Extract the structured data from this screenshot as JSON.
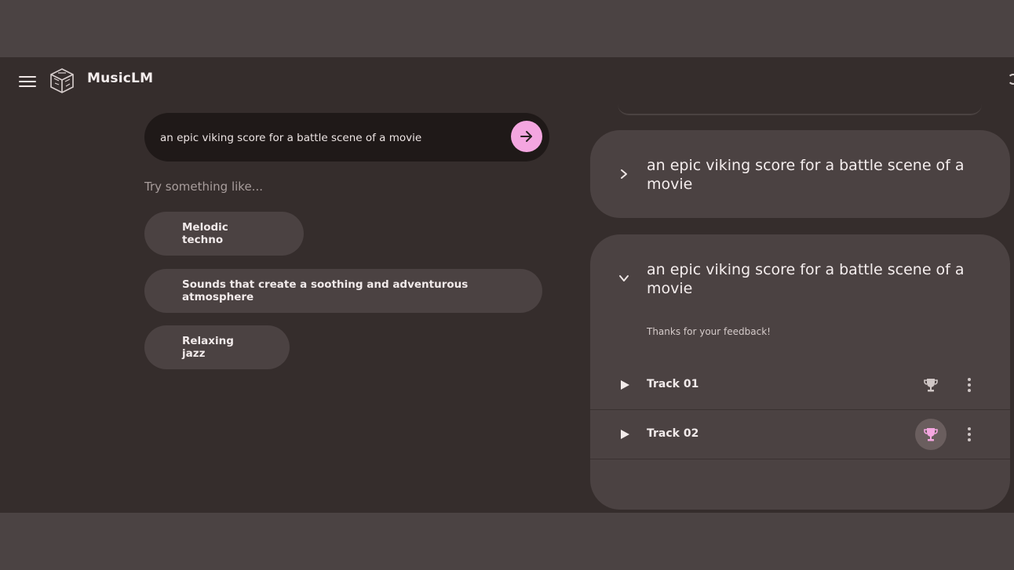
{
  "header": {
    "app_title": "MusicLM"
  },
  "prompt": {
    "value": "an epic viking score for a battle scene of a movie",
    "placeholder": ""
  },
  "suggestions": {
    "label": "Try something like...",
    "items": [
      "Melodic techno",
      "Sounds that create a soothing and adventurous atmosphere",
      "Relaxing jazz"
    ]
  },
  "results": [
    {
      "title": "an epic viking score for a battle scene of a movie",
      "expanded": false
    },
    {
      "title": "an epic viking score for a battle scene of a movie",
      "expanded": true,
      "feedback": "Thanks for your feedback!",
      "tracks": [
        {
          "name": "Track 01",
          "selected": false
        },
        {
          "name": "Track 02",
          "selected": true
        }
      ]
    }
  ],
  "colors": {
    "accent": "#f4a6e0",
    "background": "#352d2c",
    "card": "#4b4242",
    "input": "#1f1918"
  },
  "icons": {
    "menu": "menu-icon",
    "logo": "musiclm-logo",
    "submit": "arrow-right-icon",
    "collapse": "chevron-right-icon",
    "expand": "chevron-down-icon",
    "play": "play-icon",
    "trophy": "trophy-icon",
    "more": "more-vert-icon"
  }
}
